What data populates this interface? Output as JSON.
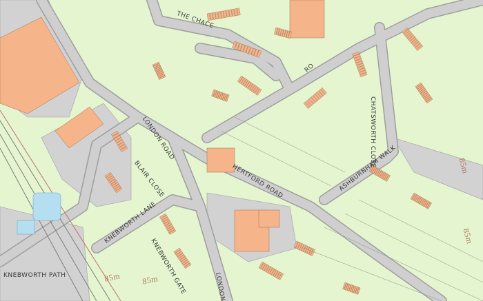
{
  "colors": {
    "land": "#e4f5cf",
    "road": "#c8c8c8",
    "road_edge": "#9e9e9e",
    "building": "#f5b48a",
    "building_edge": "#a07050",
    "hardstanding": "#d0d0d0",
    "water": "#b5dff0",
    "railway": "#8a8a8a",
    "boundary": "#777777"
  },
  "labels": {
    "the_chace": "THE CHACE",
    "london_road_1": "LONDON ROAD",
    "hertford_road": "HERTFORD ROAD",
    "chatsworth_close": "CHATSWORTH CLOSE",
    "ashburnham_walk": "ASHBURNHAM WALK",
    "blair_close": "BLAIR CLOSE",
    "knebworth_lane": "KNEBWORTH LANE",
    "knebworth_gate": "KNEBWORTH GATE",
    "knebworth_path": "KNEBWORTH PATH",
    "london_road_2": "LONDON",
    "partial_road": "RO"
  },
  "heights": {
    "h1": "85m",
    "h2": "85m",
    "h3": "85m",
    "h4": "85m"
  }
}
